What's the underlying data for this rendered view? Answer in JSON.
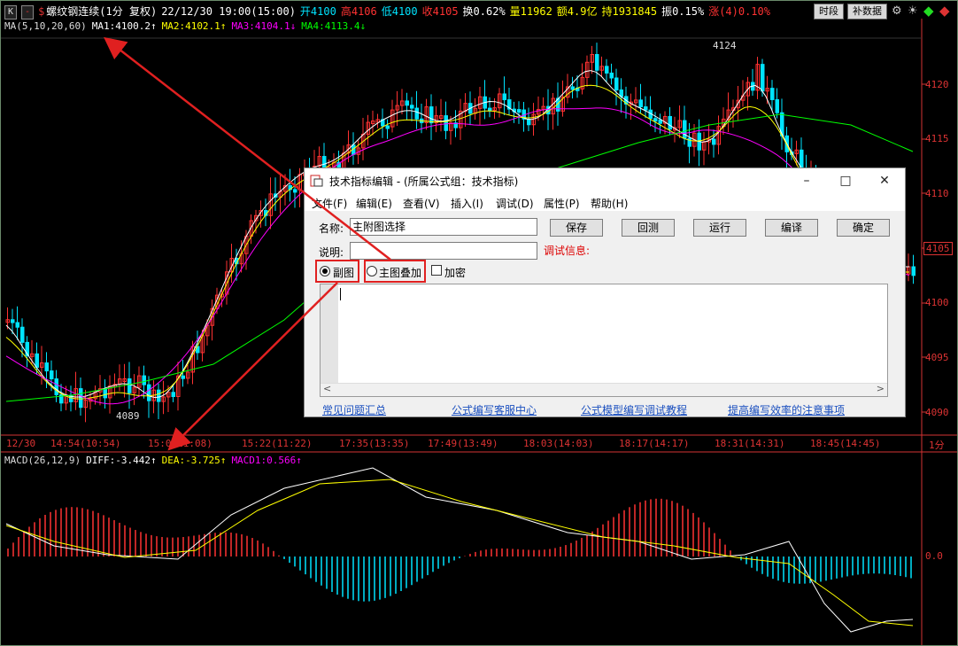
{
  "topbar": {
    "k_btn": "K",
    "minus_btn": "-",
    "dollar": "$",
    "title": "螺纹钢连续(1分 复权)",
    "datetime": "22/12/30 19:00(15:00)",
    "open": "开4100",
    "high": "高4106",
    "low": "低4100",
    "close": "收4105",
    "turnover_rate": "换0.62%",
    "volume": "量11962",
    "amount": "额4.9亿",
    "hold": "持1931845",
    "amplitude": "振0.15%",
    "change": "涨(4)0.10%",
    "btn_time": "时段",
    "btn_fill": "补数据"
  },
  "ma_line": {
    "label": "MA(5,10,20,60)",
    "ma1": "MA1:4100.2↑",
    "ma2": "MA2:4102.1↑",
    "ma3": "MA3:4104.1↓",
    "ma4": "MA4:4113.4↓"
  },
  "macd_line": {
    "label": "MACD(26,12,9)",
    "diff": "DIFF:-3.442↑",
    "dea": "DEA:-3.725↑",
    "macd1": "MACD1:0.566↑"
  },
  "y_axis": [
    "4120",
    "4115",
    "4110",
    "4105",
    "4100",
    "4095",
    "4090"
  ],
  "price_badge": "4105",
  "macd_axis": "0.0",
  "high_label": "4124",
  "low_label": "4089",
  "x_axis": [
    "12/30",
    "14:54(10:54)",
    "15:0(11:08)",
    "15:22(11:22)",
    "17:35(13:35)",
    "17:49(13:49)",
    "18:03(14:03)",
    "18:17(14:17)",
    "18:31(14:31)",
    "18:45(14:45)"
  ],
  "period": "1分",
  "colors": {
    "up": "#ff3232",
    "down": "#00e4ff",
    "ma1": "#ffffff",
    "ma2": "#ffff00",
    "ma3": "#ff00ff",
    "ma4": "#00ff00",
    "dea": "#ffff00",
    "axis": "#d33333",
    "annotation": "#e02020"
  },
  "dialog": {
    "title": "技术指标编辑 - (所属公式组：技术指标)",
    "menu": [
      "文件(F)",
      "编辑(E)",
      "查看(V)",
      "插入(I)",
      "调试(D)",
      "属性(P)",
      "帮助(H)"
    ],
    "name_label": "名称:",
    "name_value": "主附图选择",
    "desc_label": "说明:",
    "desc_value": "",
    "debug_label": "调试信息:",
    "buttons": [
      "保存",
      "回测",
      "运行",
      "编译",
      "确定"
    ],
    "radio_sub": "副图",
    "radio_overlay": "主图叠加",
    "check_encrypt": "加密",
    "links": [
      "常见问题汇总",
      "公式编写客服中心",
      "公式模型编写调试教程",
      "提高编写效率的注意事项"
    ]
  }
}
